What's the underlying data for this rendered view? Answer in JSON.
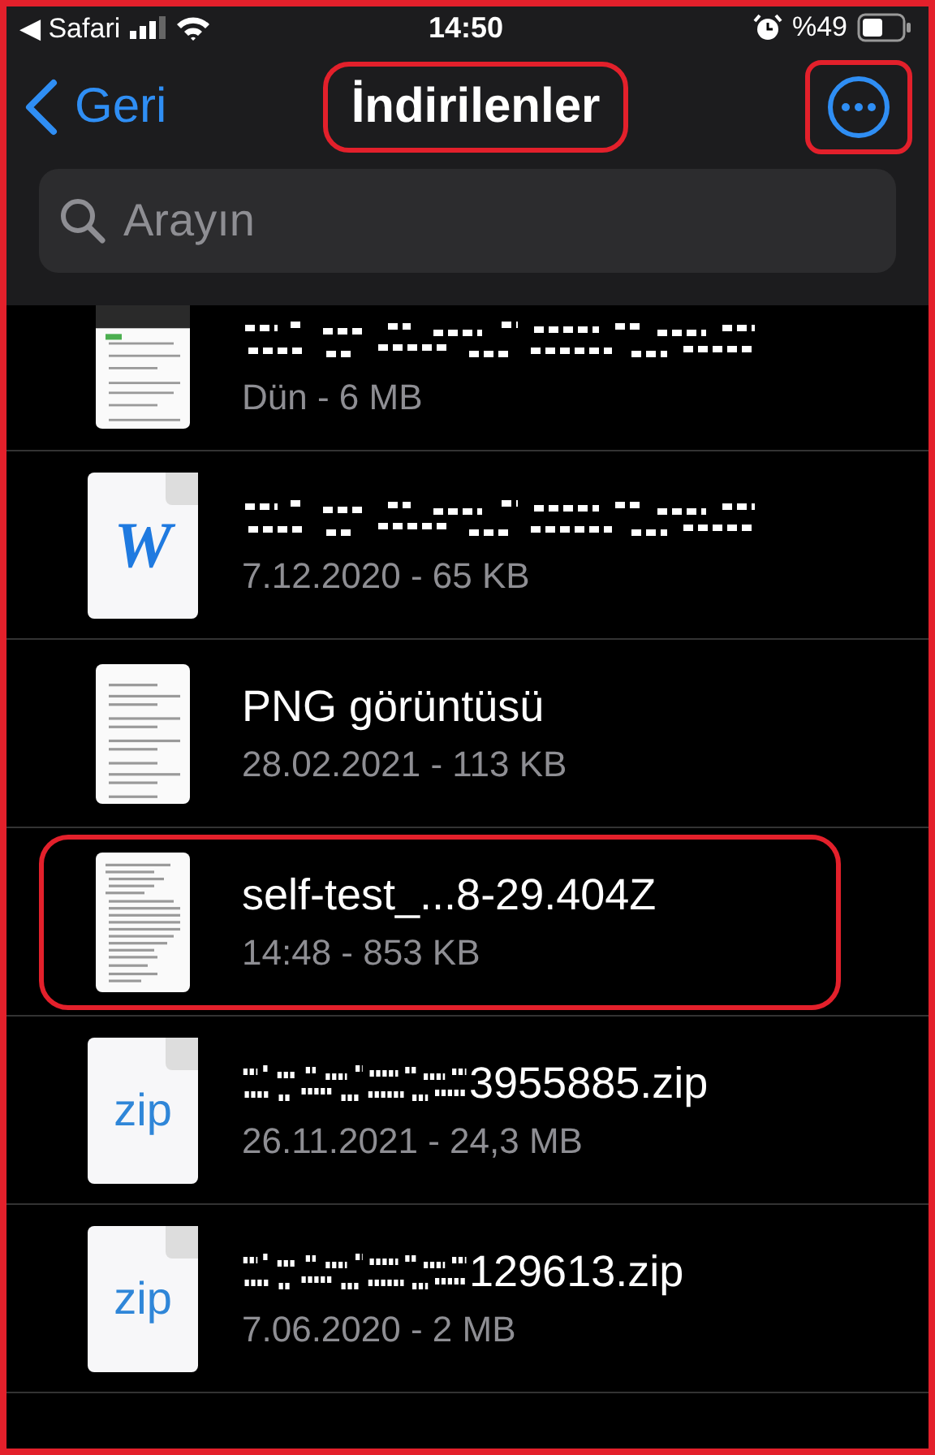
{
  "status_bar": {
    "back_app": "◀ Safari",
    "time": "14:50",
    "battery": "%49"
  },
  "nav": {
    "back": "Geri",
    "title": "İndirilenler",
    "title_highlighted": true,
    "more_highlighted": true
  },
  "search": {
    "placeholder": "Arayın"
  },
  "files": [
    {
      "kind": "preview",
      "redacted": true,
      "meta": "Dün - 6 MB",
      "highlighted": false
    },
    {
      "kind": "word",
      "icon_label": "W",
      "redacted": true,
      "meta": "7.12.2020 - 65 KB",
      "highlighted": false
    },
    {
      "kind": "preview",
      "redacted": false,
      "name": "PNG görüntüsü",
      "meta": "28.02.2021 - 113 KB",
      "highlighted": false
    },
    {
      "kind": "preview",
      "redacted": false,
      "name": "self-test_...8-29.404Z",
      "meta": "14:48 - 853 KB",
      "highlighted": true
    },
    {
      "kind": "zip",
      "icon_label": "zip",
      "redacted": true,
      "name": "3955885.zip",
      "meta": "26.11.2021 - 24,3 MB",
      "highlighted": false
    },
    {
      "kind": "zip",
      "icon_label": "zip",
      "redacted": true,
      "name": "129613.zip",
      "meta": "7.06.2020 - 2 MB",
      "highlighted": false
    }
  ]
}
